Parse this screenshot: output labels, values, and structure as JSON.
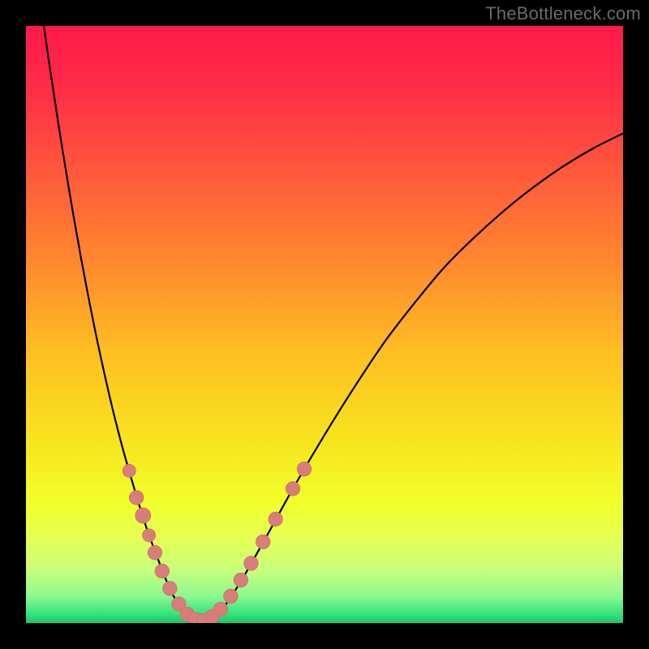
{
  "watermark": "TheBottleneck.com",
  "colors": {
    "gradient_stops": [
      {
        "offset": 0.0,
        "color": "#ff1a4b"
      },
      {
        "offset": 0.1,
        "color": "#ff2b47"
      },
      {
        "offset": 0.25,
        "color": "#ff5a3b"
      },
      {
        "offset": 0.4,
        "color": "#ff8a2e"
      },
      {
        "offset": 0.55,
        "color": "#ffbf22"
      },
      {
        "offset": 0.7,
        "color": "#f7e61e"
      },
      {
        "offset": 0.8,
        "color": "#f1ff2a"
      },
      {
        "offset": 0.86,
        "color": "#e4ff55"
      },
      {
        "offset": 0.91,
        "color": "#c8ff7a"
      },
      {
        "offset": 0.955,
        "color": "#8cf98f"
      },
      {
        "offset": 0.985,
        "color": "#34e37c"
      },
      {
        "offset": 1.0,
        "color": "#17c765"
      }
    ],
    "curve": "#000000",
    "marker_fill": "#d77d7a",
    "marker_stroke": "#c96c68"
  },
  "chart_data": {
    "type": "line",
    "title": "",
    "xlabel": "",
    "ylabel": "",
    "xlim": [
      0,
      100
    ],
    "ylim": [
      0,
      100
    ],
    "curve_left": [
      {
        "x": 3.0,
        "y": 100.0
      },
      {
        "x": 4.0,
        "y": 93.0
      },
      {
        "x": 6.0,
        "y": 80.0
      },
      {
        "x": 8.0,
        "y": 68.0
      },
      {
        "x": 10.0,
        "y": 57.0
      },
      {
        "x": 12.0,
        "y": 47.0
      },
      {
        "x": 14.0,
        "y": 38.0
      },
      {
        "x": 16.0,
        "y": 30.0
      },
      {
        "x": 18.0,
        "y": 23.0
      },
      {
        "x": 20.0,
        "y": 16.5
      },
      {
        "x": 22.0,
        "y": 11.0
      },
      {
        "x": 24.0,
        "y": 6.0
      },
      {
        "x": 26.0,
        "y": 2.3
      },
      {
        "x": 27.5,
        "y": 0.7
      },
      {
        "x": 29.0,
        "y": 0.0
      }
    ],
    "curve_right": [
      {
        "x": 29.0,
        "y": 0.0
      },
      {
        "x": 31.0,
        "y": 0.6
      },
      {
        "x": 33.0,
        "y": 2.5
      },
      {
        "x": 36.0,
        "y": 7.0
      },
      {
        "x": 40.0,
        "y": 14.0
      },
      {
        "x": 45.0,
        "y": 23.0
      },
      {
        "x": 50.0,
        "y": 31.5
      },
      {
        "x": 55.0,
        "y": 39.5
      },
      {
        "x": 60.0,
        "y": 47.0
      },
      {
        "x": 65.0,
        "y": 53.5
      },
      {
        "x": 70.0,
        "y": 59.5
      },
      {
        "x": 75.0,
        "y": 64.5
      },
      {
        "x": 80.0,
        "y": 69.0
      },
      {
        "x": 85.0,
        "y": 73.0
      },
      {
        "x": 90.0,
        "y": 76.5
      },
      {
        "x": 95.0,
        "y": 79.5
      },
      {
        "x": 100.0,
        "y": 82.0
      }
    ],
    "markers": [
      {
        "x": 17.3,
        "y": 25.5,
        "r": 1.1
      },
      {
        "x": 18.5,
        "y": 21.0,
        "r": 1.2
      },
      {
        "x": 19.6,
        "y": 18.0,
        "r": 1.3
      },
      {
        "x": 20.6,
        "y": 14.7,
        "r": 1.1
      },
      {
        "x": 21.6,
        "y": 11.8,
        "r": 1.2
      },
      {
        "x": 22.8,
        "y": 8.7,
        "r": 1.2
      },
      {
        "x": 24.1,
        "y": 5.8,
        "r": 1.2
      },
      {
        "x": 25.6,
        "y": 3.2,
        "r": 1.2
      },
      {
        "x": 27.0,
        "y": 1.5,
        "r": 1.2
      },
      {
        "x": 28.4,
        "y": 0.6,
        "r": 1.2
      },
      {
        "x": 29.8,
        "y": 0.4,
        "r": 1.2
      },
      {
        "x": 31.2,
        "y": 1.1,
        "r": 1.2
      },
      {
        "x": 32.6,
        "y": 2.3,
        "r": 1.2
      },
      {
        "x": 34.3,
        "y": 4.5,
        "r": 1.2
      },
      {
        "x": 36.0,
        "y": 7.2,
        "r": 1.2
      },
      {
        "x": 37.7,
        "y": 10.0,
        "r": 1.2
      },
      {
        "x": 39.7,
        "y": 13.6,
        "r": 1.2
      },
      {
        "x": 41.8,
        "y": 17.4,
        "r": 1.2
      },
      {
        "x": 44.7,
        "y": 22.5,
        "r": 1.2
      },
      {
        "x": 46.6,
        "y": 25.8,
        "r": 1.2
      }
    ]
  }
}
